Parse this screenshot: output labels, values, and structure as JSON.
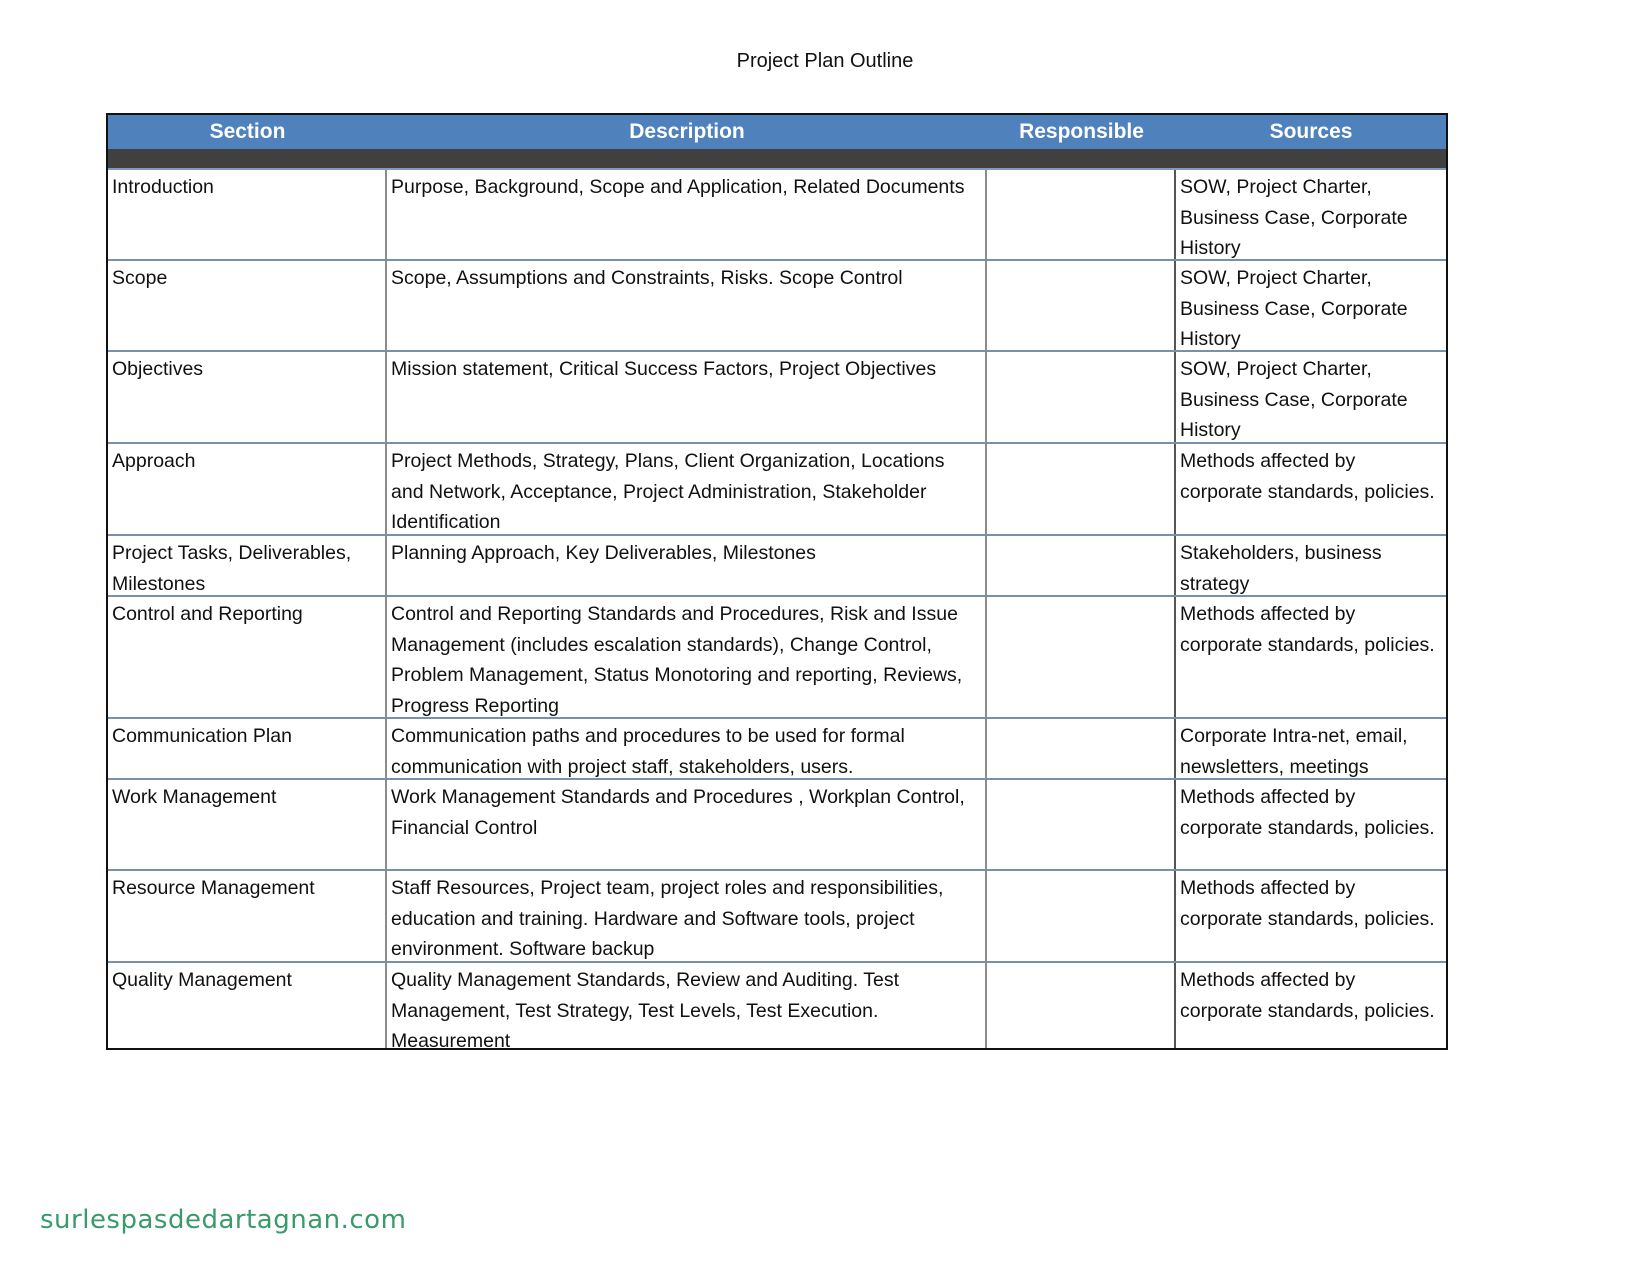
{
  "document": {
    "title": "Project Plan Outline",
    "table": {
      "columns": [
        "Section",
        "Description",
        "Responsible",
        "Sources"
      ],
      "rows": [
        {
          "section": "Introduction",
          "description": "Purpose, Background, Scope and Application, Related Documents",
          "responsible": "",
          "sources": "SOW, Project Charter, Business Case, Corporate History"
        },
        {
          "section": "Scope",
          "description": "Scope, Assumptions and Constraints, Risks. Scope Control",
          "responsible": "",
          "sources": "SOW, Project Charter, Business Case, Corporate History"
        },
        {
          "section": "Objectives",
          "description": "Mission statement, Critical Success Factors, Project Objectives",
          "responsible": "",
          "sources": "SOW, Project Charter, Business Case, Corporate History"
        },
        {
          "section": "Approach",
          "description": "Project Methods, Strategy, Plans, Client Organization, Locations and Network, Acceptance, Project Administration, Stakeholder Identification",
          "responsible": "",
          "sources": "Methods affected by corporate standards, policies."
        },
        {
          "section": "Project Tasks, Deliverables, Milestones",
          "description": "Planning Approach, Key Deliverables, Milestones",
          "responsible": "",
          "sources": "Stakeholders, business strategy"
        },
        {
          "section": "Control and Reporting",
          "description": "Control and Reporting Standards and Procedures, Risk and Issue Management (includes escalation standards), Change Control, Problem Management, Status Monotoring and reporting, Reviews, Progress Reporting",
          "responsible": "",
          "sources": "Methods affected by corporate standards, policies."
        },
        {
          "section": "Communication Plan",
          "description": "Communication paths and procedures to be used for formal communication with project staff, stakeholders, users.",
          "responsible": "",
          "sources": "Corporate Intra-net, email, newsletters, meetings"
        },
        {
          "section": "Work Management",
          "description": "Work Management Standards and Procedures , Workplan Control, Financial Control",
          "responsible": "",
          "sources": "Methods affected by corporate standards, policies."
        },
        {
          "section": "Resource Management",
          "description": "Staff Resources, Project team, project roles and responsibilities, education and training.  Hardware and Software tools, project environment. Software backup",
          "responsible": "",
          "sources": "Methods affected by corporate standards, policies."
        },
        {
          "section": "Quality Management",
          "description": "Quality Management Standards, Review and Auditing.  Test Management, Test Strategy, Test Levels, Test Execution. Measurement",
          "responsible": "",
          "sources": "Methods affected by corporate standards, policies."
        }
      ]
    }
  },
  "colors": {
    "header_bg": "#4f81bd",
    "header_band": "#404040",
    "watermark": "#3a9a6a"
  },
  "watermark": "surlespasdedartagnan.com"
}
